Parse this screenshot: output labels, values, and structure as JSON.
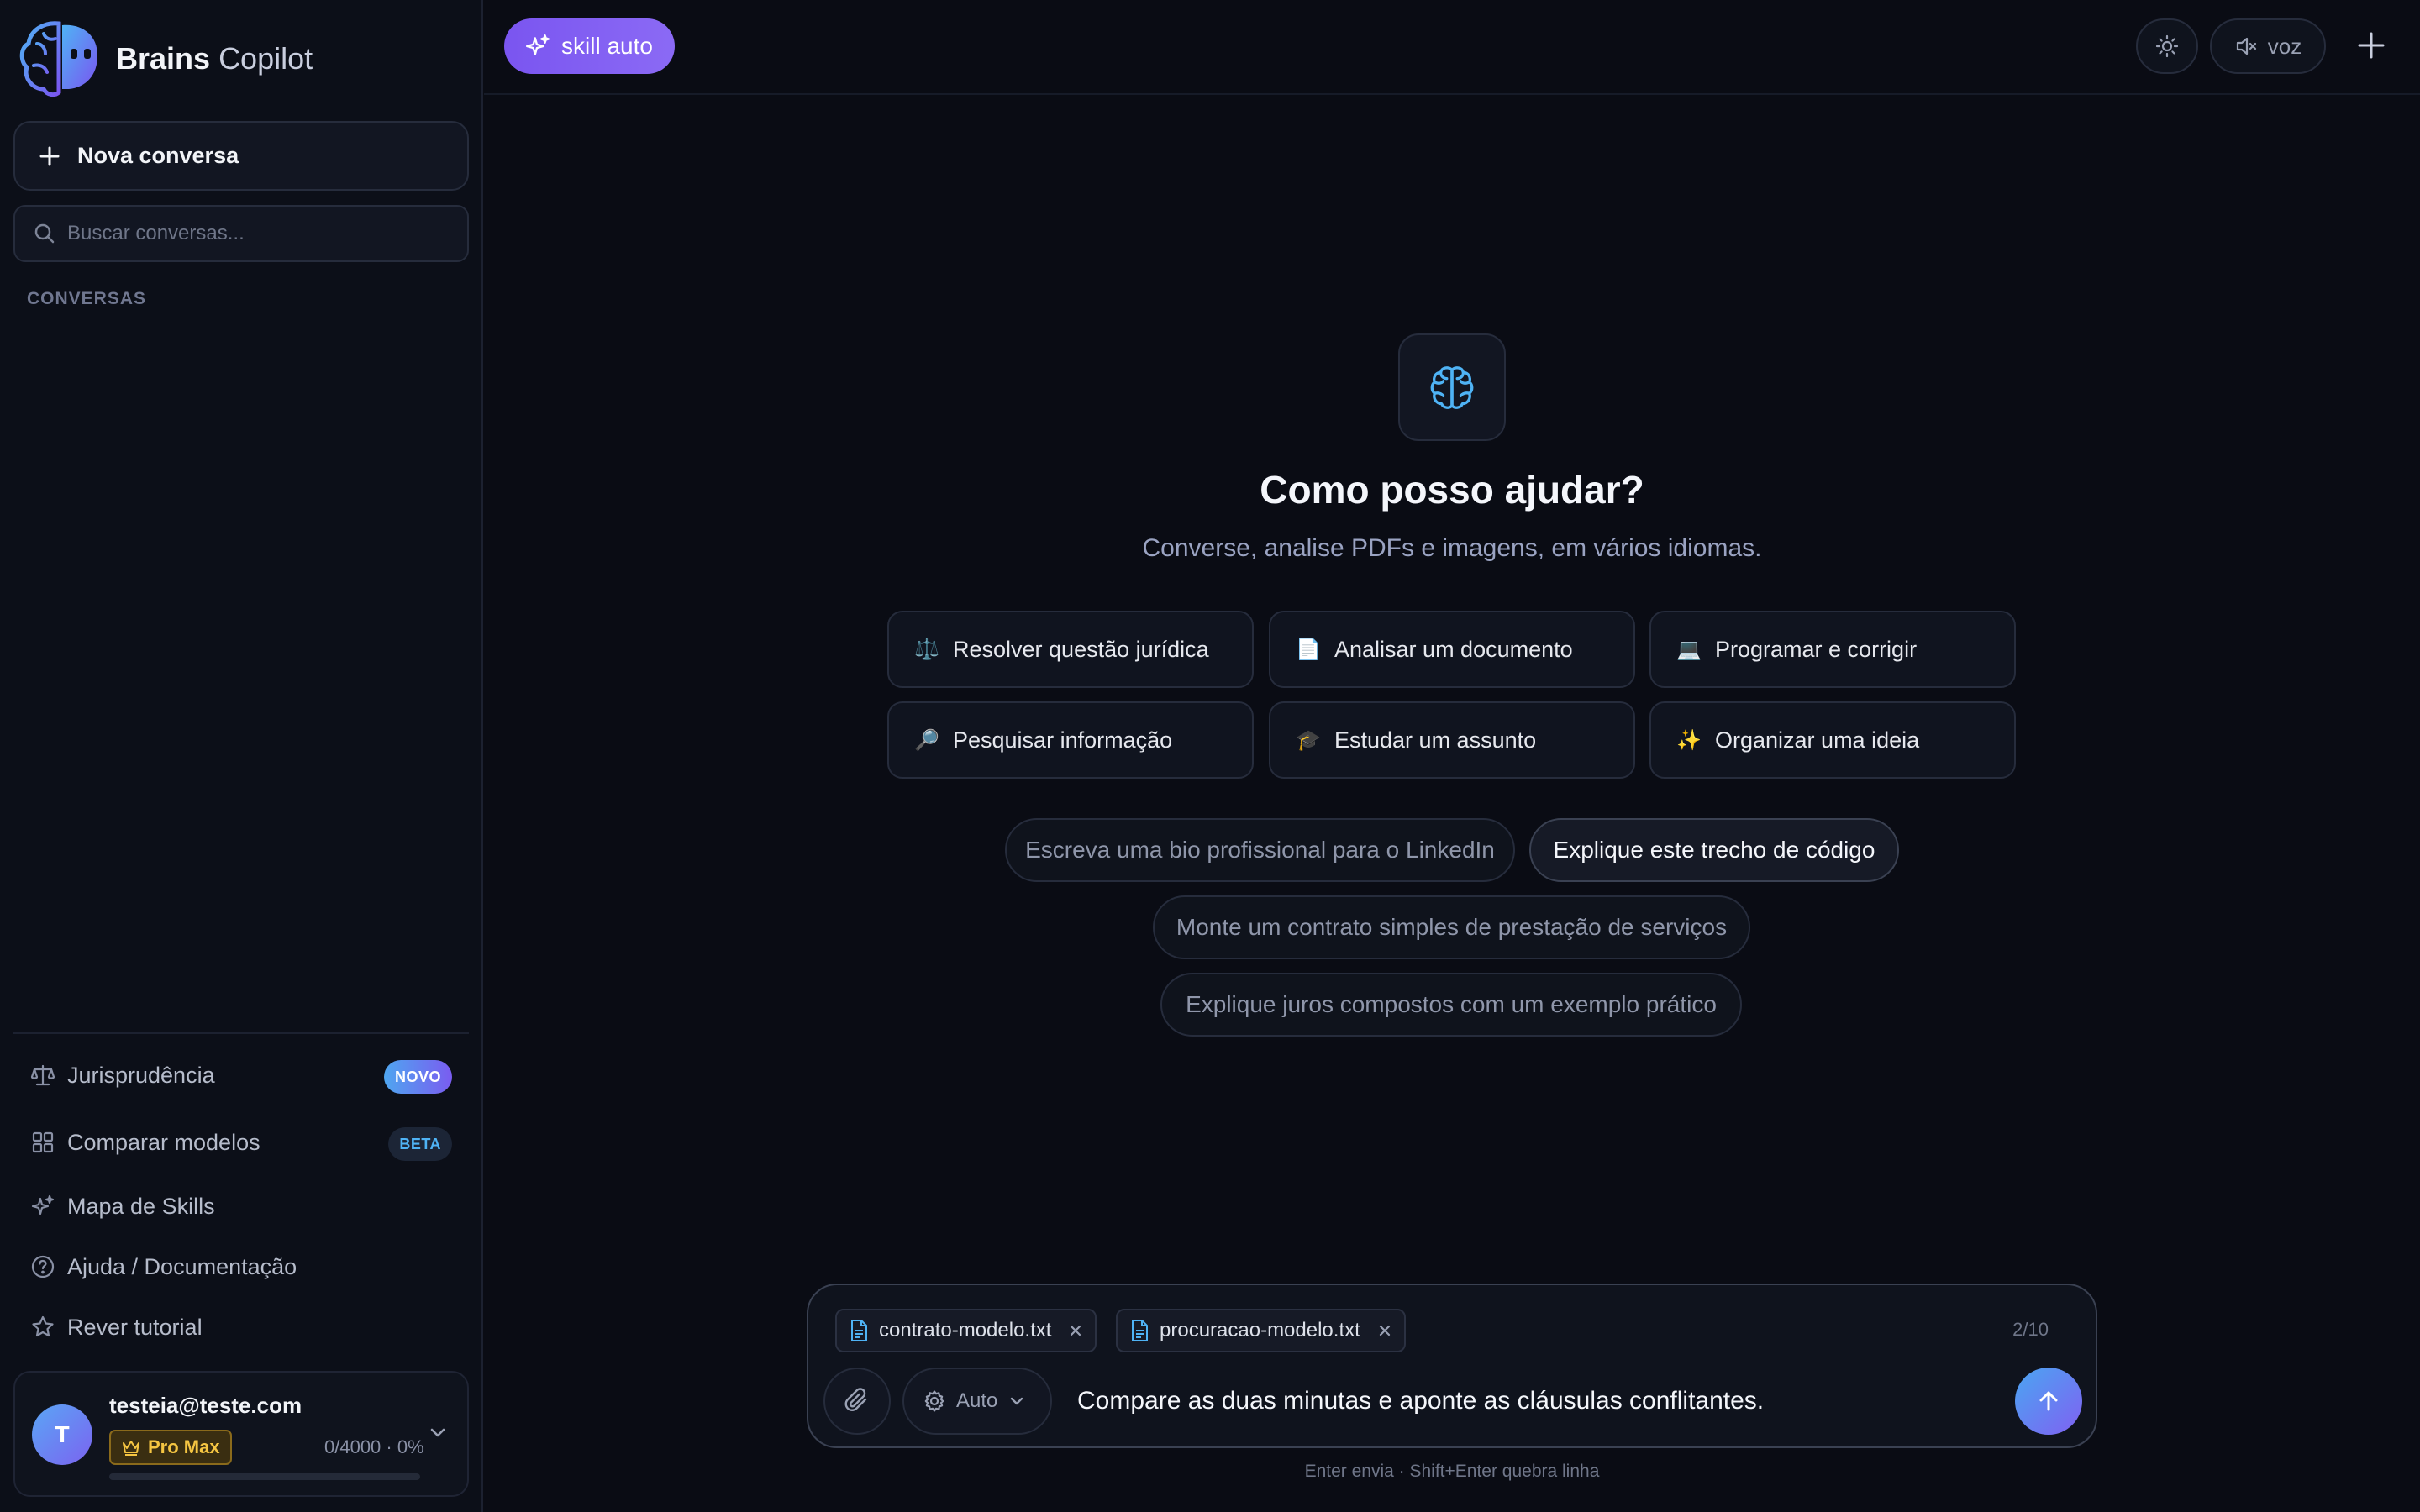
{
  "app": {
    "brand_bold": "Brains",
    "brand_light": "Copilot"
  },
  "sidebar": {
    "new_chat_label": "Nova conversa",
    "search_placeholder": "Buscar conversas...",
    "section_label": "CONVERSAS",
    "nav": [
      {
        "label": "Jurisprudência",
        "badge": "NOVO",
        "icon": "scale-icon"
      },
      {
        "label": "Comparar modelos",
        "badge": "BETA",
        "icon": "grid-icon"
      },
      {
        "label": "Mapa de Skills",
        "icon": "sparkles-icon"
      },
      {
        "label": "Ajuda / Documentação",
        "icon": "help-circle-icon"
      },
      {
        "label": "Rever tutorial",
        "icon": "star-icon"
      }
    ],
    "user": {
      "avatar_initial": "T",
      "email": "testeia@teste.com",
      "plan": "Pro Max",
      "usage_text": "0/4000 · 0%",
      "usage_fraction": 0
    }
  },
  "topbar": {
    "skill_label": "skill auto",
    "voice_label": "voz"
  },
  "main": {
    "title": "Como posso ajudar?",
    "subtitle": "Converse, analise PDFs e imagens, em vários idiomas.",
    "actions": [
      {
        "emoji": "⚖️",
        "label": "Resolver questão jurídica"
      },
      {
        "emoji": "📄",
        "label": "Analisar um documento"
      },
      {
        "emoji": "💻",
        "label": "Programar e corrigir"
      },
      {
        "emoji": "🔎",
        "label": "Pesquisar informação"
      },
      {
        "emoji": "🎓",
        "label": "Estudar um assunto"
      },
      {
        "emoji": "✨",
        "label": "Organizar uma ideia"
      }
    ],
    "suggestions": [
      "Escreva uma bio profissional para o LinkedIn",
      "Explique este trecho de código",
      "Monte um contrato simples de prestação de serviços",
      "Explique juros compostos com um exemplo prático"
    ]
  },
  "composer": {
    "files": [
      "contrato-modelo.txt",
      "procuracao-modelo.txt"
    ],
    "file_count": "2/10",
    "mode_label": "Auto",
    "message": "Compare as duas minutas e aponte as cláusulas conflitantes.",
    "hint": "Enter envia · Shift+Enter quebra linha"
  },
  "colors": {
    "accent_purple": "#7a55f0",
    "accent_blue": "#4fa6f0",
    "plan_gold": "#f5c542"
  }
}
